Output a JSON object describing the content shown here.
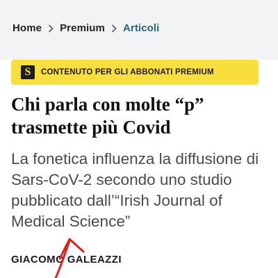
{
  "breadcrumb": {
    "items": [
      "Home",
      "Premium",
      "Articoli"
    ],
    "separator_icon": "chevron-right-icon"
  },
  "premium_banner": {
    "logo_letter": "S",
    "label": "CONTENUTO PER GLI ABBONATI PREMIUM",
    "background_color": "#f8df3e"
  },
  "article": {
    "title": "Chi parla con molte “p” trasmette più Covid",
    "subtitle": "La fonetica influenza la diffusione di Sars-CoV-2 secondo uno studio pubblicato dall’“Irish Journal of Medical Science”",
    "author": "GIACOMO GALEAZZI"
  },
  "colors": {
    "breadcrumb_current": "#27667c",
    "annotation_stroke": "#e0201b"
  }
}
